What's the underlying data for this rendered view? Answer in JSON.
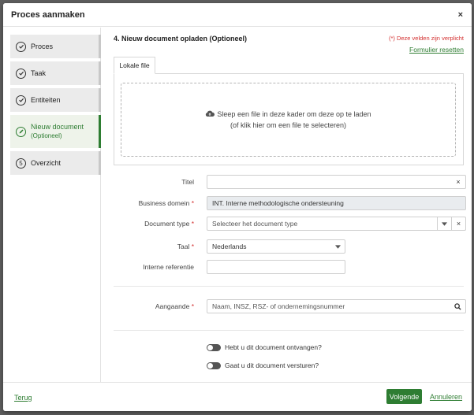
{
  "modal": {
    "title": "Proces aanmaken",
    "close": "×"
  },
  "sidebar": {
    "steps": [
      {
        "label": "Proces",
        "status": "done"
      },
      {
        "label": "Taak",
        "status": "done"
      },
      {
        "label": "Entiteiten",
        "status": "done"
      },
      {
        "label": "Nieuw document",
        "sublabel": "(Optioneel)",
        "status": "active"
      },
      {
        "label": "Overzicht",
        "number": "5",
        "status": "todo"
      }
    ]
  },
  "content": {
    "section_title": "4. Nieuw document opladen (Optioneel)",
    "required_note": "(*) Deze velden zijn verplicht",
    "reset_link": "Formulier resetten",
    "tab_label": "Lokale file",
    "dropzone": {
      "line1": "Sleep een file in deze kader om deze op te laden",
      "line2": "(of klik hier om een file te selecteren)"
    },
    "fields": {
      "titel": {
        "label": "Titel",
        "value": "",
        "clear": "×"
      },
      "business_domein": {
        "label": "Business domein",
        "value": "INT. Interne methodologische ondersteuning"
      },
      "document_type": {
        "label": "Document type",
        "placeholder": "Selecteer het document type",
        "clear": "×"
      },
      "taal": {
        "label": "Taal",
        "value": "Nederlands"
      },
      "interne_referentie": {
        "label": "Interne referentie",
        "value": ""
      },
      "aangaande": {
        "label": "Aangaande",
        "placeholder": "Naam, INSZ, RSZ- of ondernemingsnummer"
      }
    },
    "required_mark": "*",
    "toggles": [
      {
        "label": "Hebt u dit document ontvangen?",
        "on": false
      },
      {
        "label": "Gaat u dit document versturen?",
        "on": false
      }
    ]
  },
  "footer": {
    "back": "Terug",
    "next": "Volgende",
    "cancel": "Annuleren"
  },
  "colors": {
    "accent": "#2e7d32",
    "required": "#d32f2f"
  }
}
